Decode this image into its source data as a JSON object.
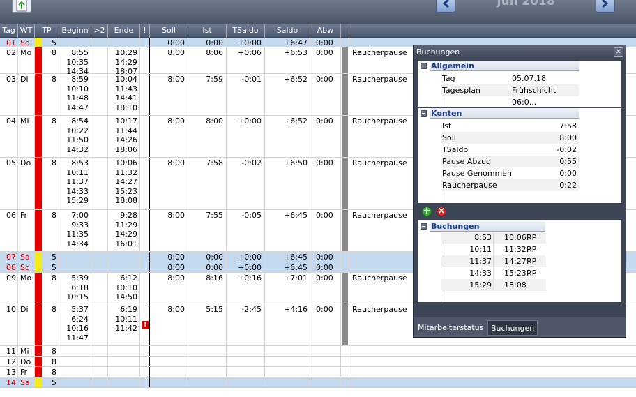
{
  "header": {
    "month_title": "Juli 2018"
  },
  "columns": [
    "Tag",
    "WT",
    "TP",
    "Beginn",
    ">2",
    "Ende",
    "!",
    "Soll",
    "Ist",
    "TSaldo",
    "Saldo",
    "Abw"
  ],
  "rows": [
    {
      "tag": "01",
      "wt": "So",
      "tp": "5",
      "color": "yellow",
      "weekend": true,
      "beginn": "",
      "ende": "",
      "soll": "0:00",
      "ist": "0:00",
      "tsaldo": "+0:00",
      "saldo": "+6:47",
      "abw": "0:00",
      "bar": false,
      "remark": "",
      "warn": false
    },
    {
      "tag": "02",
      "wt": "Mo",
      "tp": "8",
      "color": "red",
      "weekend": false,
      "beginn": "8:55\n10:35\n14:34",
      "ende": "10:29\n14:29\n18:07",
      "soll": "8:00",
      "ist": "8:06",
      "tsaldo": "+0:06",
      "saldo": "+6:53",
      "abw": "0:00",
      "bar": true,
      "remark": "Raucherpause",
      "warn": false
    },
    {
      "tag": "03",
      "wt": "Di",
      "tp": "8",
      "color": "red",
      "weekend": false,
      "beginn": "8:59\n10:10\n11:48\n14:47",
      "ende": "10:04\n11:43\n14:41\n18:10",
      "soll": "8:00",
      "ist": "7:59",
      "tsaldo": "-0:01",
      "saldo": "+6:52",
      "abw": "0:00",
      "bar": true,
      "remark": "Raucherpause",
      "warn": false
    },
    {
      "tag": "04",
      "wt": "Mi",
      "tp": "8",
      "color": "red",
      "weekend": false,
      "beginn": "8:54\n10:22\n11:50\n14:32",
      "ende": "10:17\n11:44\n14:26\n18:06",
      "soll": "8:00",
      "ist": "8:00",
      "tsaldo": "+0:00",
      "saldo": "+6:52",
      "abw": "0:00",
      "bar": true,
      "remark": "Raucherpause",
      "warn": false
    },
    {
      "tag": "05",
      "wt": "Do",
      "tp": "8",
      "color": "red",
      "weekend": false,
      "beginn": "8:53\n10:11\n11:37\n14:33\n15:29",
      "ende": "10:06\n11:32\n14:27\n15:23\n18:08",
      "soll": "8:00",
      "ist": "7:58",
      "tsaldo": "-0:02",
      "saldo": "+6:50",
      "abw": "0:00",
      "bar": true,
      "remark": "Raucherpause",
      "warn": false
    },
    {
      "tag": "06",
      "wt": "Fr",
      "tp": "8",
      "color": "red",
      "weekend": false,
      "beginn": "7:00\n9:33\n11:35\n14:34",
      "ende": "9:28\n11:29\n14:29\n16:01",
      "soll": "8:00",
      "ist": "7:55",
      "tsaldo": "-0:05",
      "saldo": "+6:45",
      "abw": "0:00",
      "bar": true,
      "remark": "Raucherpause",
      "warn": false
    },
    {
      "tag": "07",
      "wt": "Sa",
      "tp": "5",
      "color": "yellow",
      "weekend": true,
      "beginn": "",
      "ende": "",
      "soll": "0:00",
      "ist": "0:00",
      "tsaldo": "+0:00",
      "saldo": "+6:45",
      "abw": "0:00",
      "bar": false,
      "remark": "",
      "warn": false
    },
    {
      "tag": "08",
      "wt": "So",
      "tp": "5",
      "color": "yellow",
      "weekend": true,
      "beginn": "",
      "ende": "",
      "soll": "0:00",
      "ist": "0:00",
      "tsaldo": "+0:00",
      "saldo": "+6:45",
      "abw": "0:00",
      "bar": false,
      "remark": "",
      "warn": false
    },
    {
      "tag": "09",
      "wt": "Mo",
      "tp": "8",
      "color": "red",
      "weekend": false,
      "beginn": "5:39\n6:18\n10:15",
      "ende": "6:12\n10:10\n14:50",
      "soll": "8:00",
      "ist": "8:16",
      "tsaldo": "+0:16",
      "saldo": "+7:01",
      "abw": "0:00",
      "bar": true,
      "remark": "Raucherpause",
      "warn": false
    },
    {
      "tag": "10",
      "wt": "Di",
      "tp": "8",
      "color": "red",
      "weekend": false,
      "beginn": "5:37\n6:24\n10:16\n11:47",
      "ende": "6:19\n10:11\n11:42",
      "soll": "8:00",
      "ist": "5:15",
      "tsaldo": "-2:45",
      "saldo": "+4:16",
      "abw": "0:00",
      "bar": true,
      "remark": "Raucherpause",
      "warn": true
    },
    {
      "tag": "11",
      "wt": "Mi",
      "tp": "8",
      "color": "red",
      "weekend": false,
      "beginn": "",
      "ende": "",
      "soll": "",
      "ist": "",
      "tsaldo": "",
      "saldo": "",
      "abw": "",
      "bar": false,
      "remark": "",
      "warn": false
    },
    {
      "tag": "12",
      "wt": "Do",
      "tp": "8",
      "color": "red",
      "weekend": false,
      "beginn": "",
      "ende": "",
      "soll": "",
      "ist": "",
      "tsaldo": "",
      "saldo": "",
      "abw": "",
      "bar": false,
      "remark": "",
      "warn": false
    },
    {
      "tag": "13",
      "wt": "Fr",
      "tp": "8",
      "color": "red",
      "weekend": false,
      "beginn": "",
      "ende": "",
      "soll": "",
      "ist": "",
      "tsaldo": "",
      "saldo": "",
      "abw": "",
      "bar": false,
      "remark": "",
      "warn": false
    },
    {
      "tag": "14",
      "wt": "Sa",
      "tp": "5",
      "color": "yellow",
      "weekend": true,
      "beginn": "",
      "ende": "",
      "soll": "",
      "ist": "",
      "tsaldo": "",
      "saldo": "",
      "abw": "",
      "bar": false,
      "remark": "",
      "warn": false
    }
  ],
  "panel": {
    "title": "Buchungen",
    "allgemein": {
      "title": "Allgemein",
      "items": [
        {
          "label": "Tag",
          "value": "05.07.18"
        },
        {
          "label": "Tagesplan",
          "value": "Frühschicht 06:0..."
        }
      ]
    },
    "konten": {
      "title": "Konten",
      "items": [
        {
          "label": "Ist",
          "value": "7:58"
        },
        {
          "label": "Soll",
          "value": "8:00"
        },
        {
          "label": "TSaldo",
          "value": "-0:02"
        },
        {
          "label": "Pause Abzug",
          "value": "0:55"
        },
        {
          "label": "Pause Genommen",
          "value": "0:00"
        },
        {
          "label": "Raucherpause",
          "value": "0:22"
        }
      ]
    },
    "buchungen": {
      "title": "Buchungen",
      "items": [
        {
          "begin": "8:53",
          "end": "10:06",
          "type": "RP"
        },
        {
          "begin": "10:11",
          "end": "11:32",
          "type": "RP"
        },
        {
          "begin": "11:37",
          "end": "14:27",
          "type": "RP"
        },
        {
          "begin": "14:33",
          "end": "15:23",
          "type": "RP"
        },
        {
          "begin": "15:29",
          "end": "18:08",
          "type": ""
        }
      ]
    },
    "tabs": [
      "Mitarbeiterstatus",
      "Buchungen"
    ]
  },
  "colors": {
    "red": "#e60000",
    "yellow": "#f4ea1c",
    "weekend": "#c5d9ee",
    "header": "#5b677c"
  }
}
